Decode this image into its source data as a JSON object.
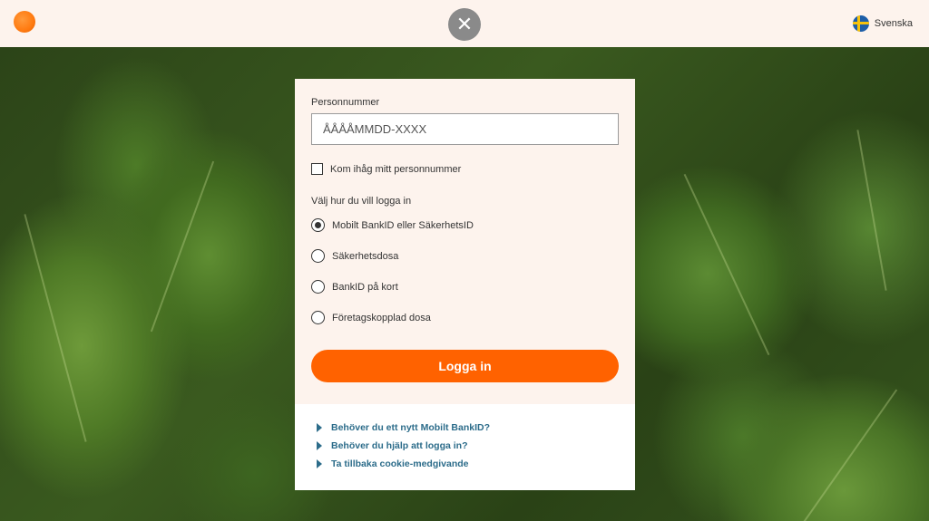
{
  "header": {
    "close_symbol": "✕",
    "language": "Svenska"
  },
  "form": {
    "pnr_label": "Personnummer",
    "pnr_placeholder": "ÅÅÅÅMMDD-XXXX",
    "pnr_value": "",
    "remember_label": "Kom ihåg mitt personnummer",
    "remember_checked": false,
    "method_label": "Välj hur du vill logga in",
    "methods": [
      {
        "label": "Mobilt BankID eller SäkerhetsID",
        "selected": true
      },
      {
        "label": "Säkerhetsdosa",
        "selected": false
      },
      {
        "label": "BankID på kort",
        "selected": false
      },
      {
        "label": "Företagskopplad dosa",
        "selected": false
      }
    ],
    "submit_label": "Logga in"
  },
  "help_links": [
    "Behöver du ett nytt Mobilt BankID?",
    "Behöver du hjälp att logga in?",
    "Ta tillbaka cookie-medgivande"
  ],
  "colors": {
    "accent": "#ff6200",
    "link": "#2c6c8a",
    "panel": "#fdf3ed"
  },
  "icons": {
    "logo": "orange-circle-logo",
    "close": "close-icon",
    "flag": "swedish-flag-icon",
    "link_arrow": "triangle-right-icon"
  }
}
